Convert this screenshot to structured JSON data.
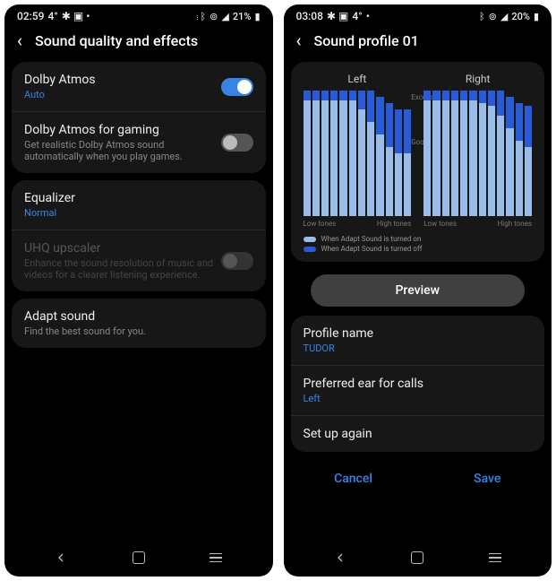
{
  "left_screen": {
    "status": {
      "time": "02:59",
      "temp": "4°",
      "battery": "21%"
    },
    "header": "Sound quality and effects",
    "dolby": {
      "title": "Dolby Atmos",
      "sub": "Auto",
      "on": true
    },
    "dolby_gaming": {
      "title": "Dolby Atmos for gaming",
      "sub": "Get realistic Dolby Atmos sound automatically when you play games.",
      "on": false
    },
    "equalizer": {
      "title": "Equalizer",
      "sub": "Normal"
    },
    "uhq": {
      "title": "UHQ upscaler",
      "sub": "Enhance the sound resolution of music and videos for a clearer listening experience.",
      "on": false
    },
    "adapt": {
      "title": "Adapt sound",
      "sub": "Find the best sound for you."
    }
  },
  "right_screen": {
    "status": {
      "time": "03:08",
      "temp": "4°",
      "battery": "20%"
    },
    "header": "Sound profile 01",
    "chart_left_title": "Left",
    "chart_right_title": "Right",
    "side_label_top": "Excellent",
    "side_label_mid": "Good",
    "x_low": "Low tones",
    "x_high": "High tones",
    "legend_on": "When Adapt Sound is turned on",
    "legend_off": "When Adapt Sound is turned off",
    "preview": "Preview",
    "profile_name": {
      "title": "Profile name",
      "value": "TUDOR"
    },
    "preferred_ear": {
      "title": "Preferred ear for calls",
      "value": "Left"
    },
    "setup_again": "Set up again",
    "cancel": "Cancel",
    "save": "Save"
  },
  "chart_data": [
    {
      "type": "bar",
      "title": "Left",
      "xlabel_left": "Low tones",
      "xlabel_right": "High tones",
      "ylabels": [
        "Good",
        "Excellent"
      ],
      "series": [
        {
          "name": "Adapt Sound off",
          "color": "#99bde8",
          "values": [
            92,
            92,
            92,
            92,
            92,
            92,
            85,
            75,
            65,
            55,
            50,
            50
          ]
        },
        {
          "name": "Adapt Sound on",
          "color": "#2a5bd6",
          "values": [
            100,
            100,
            100,
            100,
            100,
            100,
            100,
            100,
            95,
            90,
            85,
            85
          ]
        }
      ]
    },
    {
      "type": "bar",
      "title": "Right",
      "xlabel_left": "Low tones",
      "xlabel_right": "High tones",
      "ylabels": [
        "Good",
        "Excellent"
      ],
      "series": [
        {
          "name": "Adapt Sound off",
          "color": "#99bde8",
          "values": [
            92,
            92,
            92,
            92,
            92,
            92,
            90,
            88,
            80,
            70,
            60,
            55
          ]
        },
        {
          "name": "Adapt Sound on",
          "color": "#2a5bd6",
          "values": [
            100,
            100,
            100,
            100,
            100,
            100,
            100,
            100,
            100,
            95,
            90,
            88
          ]
        }
      ]
    }
  ]
}
